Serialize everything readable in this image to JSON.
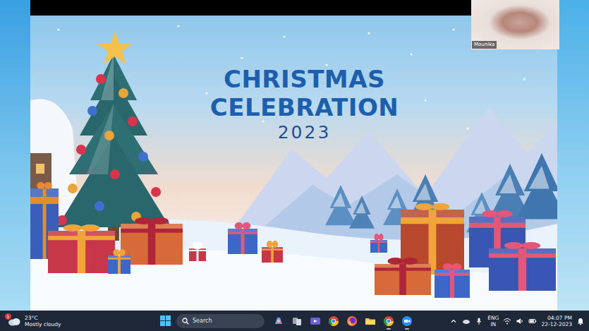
{
  "meeting": {
    "participant": {
      "name": "Mounika"
    }
  },
  "slide": {
    "title_lines": [
      "CHRISTMAS",
      "CELEBRATION"
    ],
    "year": "2023"
  },
  "taskbar": {
    "weather": {
      "badge": "1",
      "temperature": "23°C",
      "condition": "Mostly cloudy"
    },
    "search": {
      "placeholder": "Search"
    },
    "apps": [
      {
        "kind": "copilot",
        "running": false
      },
      {
        "kind": "task-view",
        "running": false
      },
      {
        "kind": "meet",
        "running": false
      },
      {
        "kind": "chrome",
        "running": false
      },
      {
        "kind": "firefox",
        "running": false
      },
      {
        "kind": "explorer",
        "running": false
      },
      {
        "kind": "chrome-profile",
        "running": true
      },
      {
        "kind": "zoom",
        "running": true
      }
    ],
    "tray": {
      "language": "ENG",
      "region": "IN",
      "time": "04:07 PM",
      "date": "22-12-2023"
    }
  }
}
